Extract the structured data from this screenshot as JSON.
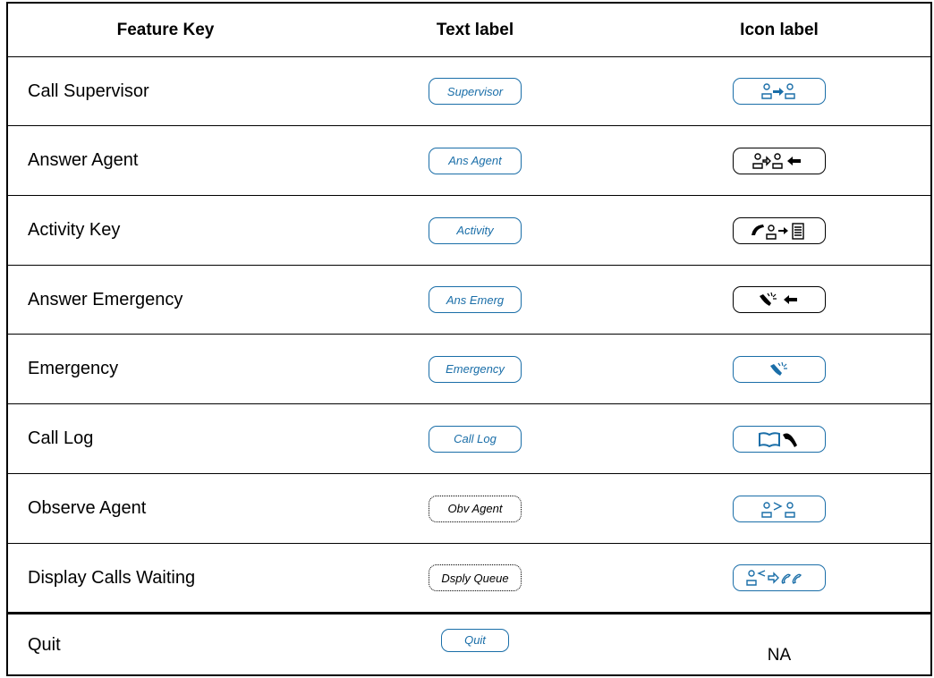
{
  "header": {
    "feature_key": "Feature Key",
    "text_label": "Text label",
    "icon_label": "Icon label"
  },
  "rows": [
    {
      "feature": "Call Supervisor",
      "text_label": "Supervisor",
      "icon": "call-supervisor-icon"
    },
    {
      "feature": "Answer Agent",
      "text_label": "Ans Agent",
      "icon": "answer-agent-icon"
    },
    {
      "feature": "Activity Key",
      "text_label": "Activity",
      "icon": "activity-key-icon"
    },
    {
      "feature": "Answer Emergency",
      "text_label": "Ans Emerg",
      "icon": "answer-emergency-icon"
    },
    {
      "feature": "Emergency",
      "text_label": "Emergency",
      "icon": "emergency-icon"
    },
    {
      "feature": "Call Log",
      "text_label": "Call Log",
      "icon": "call-log-icon"
    },
    {
      "feature": "Observe Agent",
      "text_label": "Obv Agent",
      "icon": "observe-agent-icon"
    },
    {
      "feature": "Display Calls Waiting",
      "text_label": "Dsply Queue",
      "icon": "display-calls-waiting-icon"
    },
    {
      "feature": "Quit",
      "text_label": "Quit",
      "icon_text": "NA"
    }
  ],
  "colors": {
    "blue_key": "#1a6ea8",
    "black_key": "#000000"
  }
}
